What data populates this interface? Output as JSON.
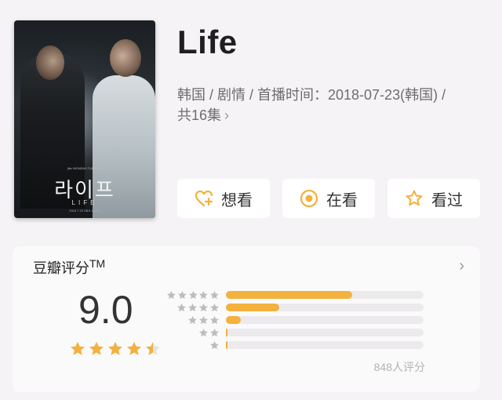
{
  "movie": {
    "title": "Life",
    "meta_line1": "韩国 / 剧情 / 首播时间：2018-07-23(韩国) /",
    "meta_line2": "共16集",
    "chevron": "›",
    "poster": {
      "title_kr": "라이프",
      "title_en": "LIFE",
      "tiny_text": "2018 7 23 SBS 11 jtbc",
      "top_text": "jtbc MONDAY-TUESDAY"
    }
  },
  "actions": [
    {
      "label": "想看",
      "icon": "heart-plus-icon"
    },
    {
      "label": "在看",
      "icon": "target-icon"
    },
    {
      "label": "看过",
      "icon": "star-outline-icon"
    }
  ],
  "rating": {
    "title": "豆瓣评分",
    "tm": "TM",
    "chevron": "›",
    "score": "9.0",
    "stars_value": 4.5,
    "raters": "848人评分",
    "distribution": [
      {
        "stars": 5,
        "fraction": 0.64
      },
      {
        "stars": 4,
        "fraction": 0.27
      },
      {
        "stars": 3,
        "fraction": 0.075
      },
      {
        "stars": 2,
        "fraction": 0.008
      },
      {
        "stars": 1,
        "fraction": 0.008
      }
    ]
  },
  "colors": {
    "accent": "#f3b13d",
    "star_gray": "#bdbdbd"
  }
}
